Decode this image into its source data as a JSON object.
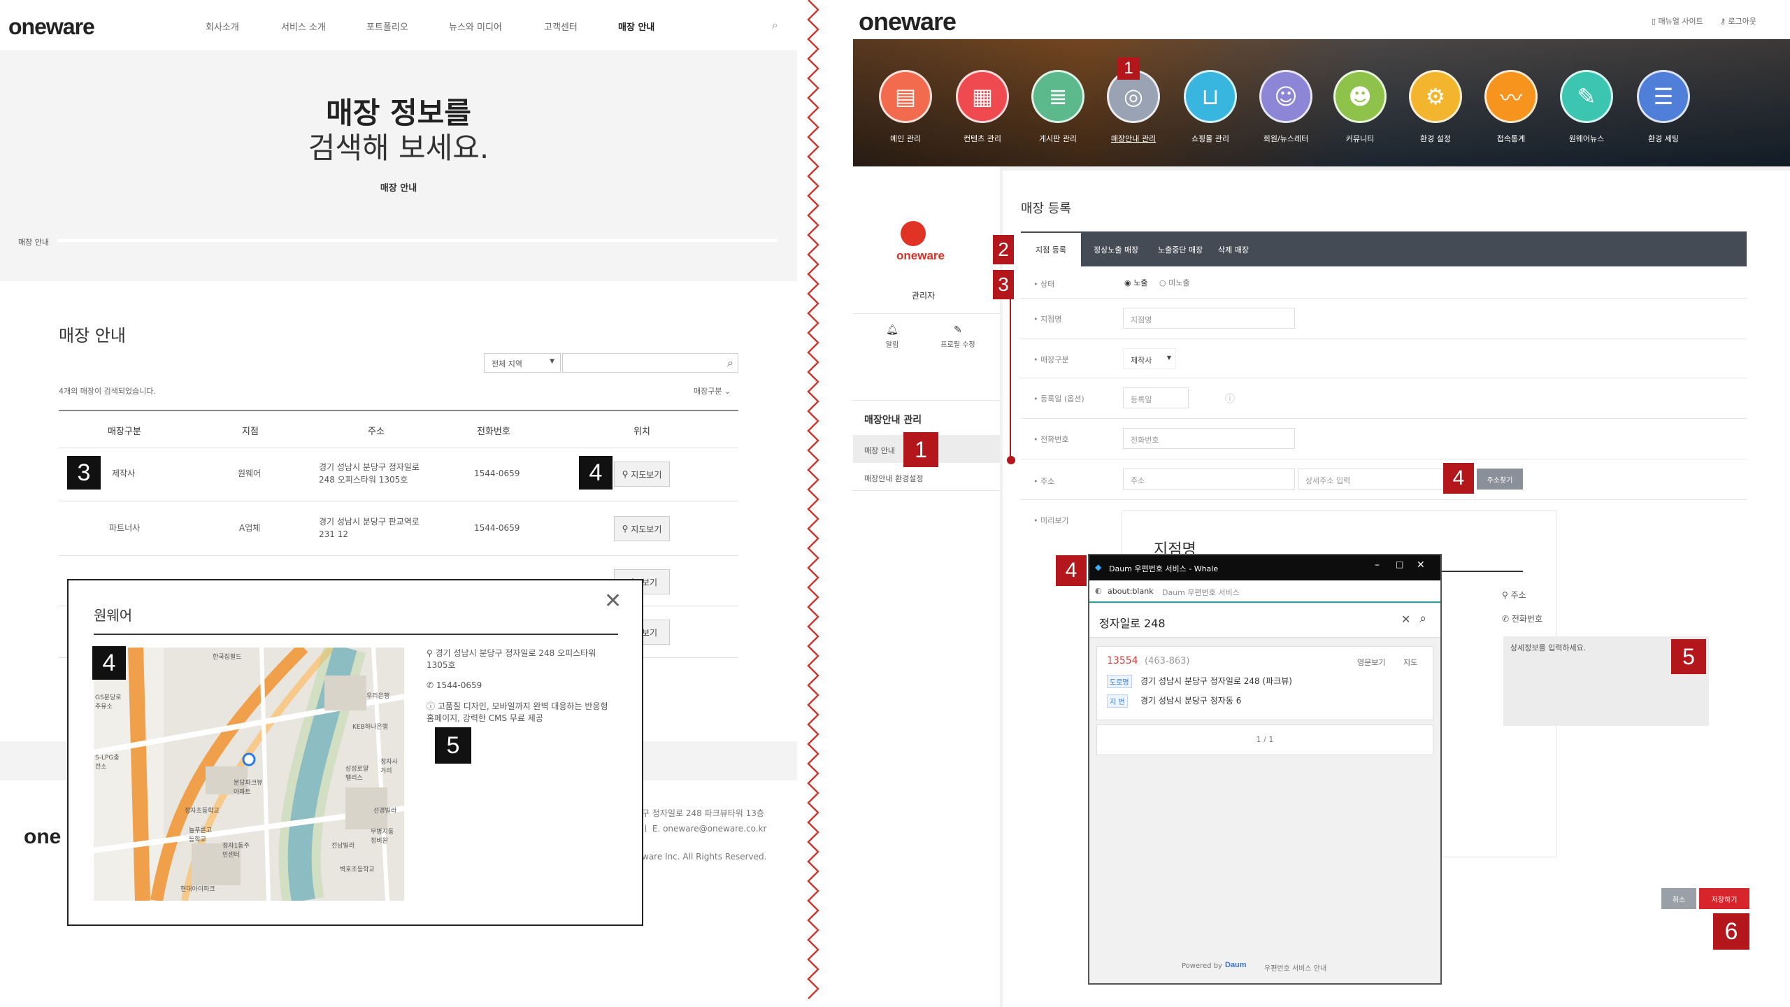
{
  "left": {
    "logo": "oneware",
    "nav": [
      "회사소개",
      "서비스 소개",
      "포트폴리오",
      "뉴스와 미디어",
      "고객센터",
      "매장 안내"
    ],
    "hero_title_bold": "매장 정보를",
    "hero_title_light": "검색해 보세요.",
    "hero_sub": "매장 안내",
    "breadcrumb": "매장 안내",
    "section_title": "매장 안내",
    "region_select": "전체 지역",
    "result_count": "4개의 매장이 검색되었습니다.",
    "sort_label": "매장구분",
    "columns": [
      "매장구분",
      "지점",
      "주소",
      "전화번호",
      "위치"
    ],
    "rows": [
      {
        "type": "제작사",
        "branch": "원웨어",
        "addr1": "경기 성남시 분당구 정자일로",
        "addr2": "248 오피스타워 1305호",
        "phone": "1544-0659",
        "map": "지도보기"
      },
      {
        "type": "파트너사",
        "branch": "A업체",
        "addr1": "경기 성남시 분당구 판교역로",
        "addr2": "231 12",
        "phone": "1544-0659",
        "map": "지도보기"
      }
    ],
    "map_btn": "지도보기",
    "modal": {
      "title": "원웨어",
      "address": "경기 성남시 분당구 정자일로 248 오피스타워 1305호",
      "phone": "1544-0659",
      "desc": "고품질 디자인, 모바일까지 완벽 대응하는 반응형 홈페이지, 강력한 CMS 무료 제공",
      "map_labels": [
        "한국집필드",
        "GS분당로주유소",
        "S-LPG충전소",
        "우리은행",
        "KEB하나은행",
        "분당파크뷰아파트",
        "정자초등학교",
        "늘푸른고등학교",
        "정자1동주민센터",
        "현대아이파크",
        "삼성로얄팰리스",
        "선경빌라",
        "정자사거리",
        "무병지동 정비원",
        "벽호초등학교",
        "전남빌라"
      ]
    },
    "footer_addr": "구 정자일로 248 파크뷰타워 13층",
    "footer_email": "ㅣ E. oneware@oneware.co.kr",
    "footer_copy": "ware Inc.  All Rights Reserved.",
    "footer_logo": "one"
  },
  "right": {
    "logo": "oneware",
    "top_links": [
      "매뉴얼 사이트",
      "로그아웃"
    ],
    "menu": [
      {
        "label": "메인 관리",
        "color": "#f26b4e",
        "icon": "▤"
      },
      {
        "label": "컨텐츠 관리",
        "color": "#ef4a4f",
        "icon": "▦"
      },
      {
        "label": "게시판 관리",
        "color": "#5bb98c",
        "icon": "≣"
      },
      {
        "label": "매장안내 관리",
        "color": "#9aa3b3",
        "icon": "◎"
      },
      {
        "label": "쇼핑몰 관리",
        "color": "#38b6e0",
        "icon": "⊔"
      },
      {
        "label": "회원/뉴스레터",
        "color": "#8d86d6",
        "icon": "☺"
      },
      {
        "label": "커뮤니티",
        "color": "#8ec24a",
        "icon": "☻"
      },
      {
        "label": "환경 설정",
        "color": "#f4b52e",
        "icon": "⚙"
      },
      {
        "label": "접속통계",
        "color": "#f7941d",
        "icon": "〰"
      },
      {
        "label": "원웨어뉴스",
        "color": "#3cc5b0",
        "icon": "✎"
      },
      {
        "label": "환경 세팅",
        "color": "#4f7fd9",
        "icon": "☰"
      }
    ],
    "sidebar_brand": "oneware",
    "sidebar_role": "관리자",
    "sidebar_alarm": "알림",
    "sidebar_profile": "프로필 수정",
    "sidebar_section": "매장안내 관리",
    "sidebar_items": [
      "매장 안내",
      "매장안내 환경설정"
    ],
    "page_title": "매장 등록",
    "tabs": [
      "지점 등록",
      "정상노출 매장",
      "노출중단 매장",
      "삭제 매장"
    ],
    "form": {
      "status_label": "상태",
      "status_options": [
        "노출",
        "미노출"
      ],
      "name_label": "지점명",
      "name_placeholder": "지점명",
      "type_label": "매장구분",
      "type_value": "제작사",
      "date_label": "등록일 (옵션)",
      "date_placeholder": "등록일",
      "phone_label": "전화번호",
      "phone_placeholder": "전화번호",
      "addr_label": "주소",
      "addr_placeholder": "주소",
      "addr_detail_placeholder": "상세주소 입력",
      "addr_btn": "주소찾기",
      "preview_label": "미리보기",
      "preview_title": "지점명",
      "preview_addr": "주소",
      "preview_phone": "전화번호",
      "preview_detail": "상세정보를 입력하세요.",
      "cancel_btn": "취소",
      "save_btn": "저장하기"
    },
    "popup": {
      "title": "Daum 우편번호 서비스 - Whale",
      "url": "about:blank",
      "url_desc": "Daum 우편번호 서비스",
      "query": "정자일로 248",
      "zip": "13554",
      "zip_old": "(463-863)",
      "en_label": "영문보기",
      "map_label": "지도",
      "road_tag": "도로명",
      "road_addr": "경기 성남시 분당구 정자일로 248 (파크뷰)",
      "lot_tag": "지 번",
      "lot_addr": "경기 성남시 분당구 정자동 6",
      "pager": "1 / 1",
      "powered": "Powered by",
      "daum": "Daum",
      "guide": "우편번호 서비스 안내"
    }
  },
  "badges": {
    "b1": "1",
    "b2": "2",
    "b3": "3",
    "b4": "4",
    "b5": "5",
    "b6": "6"
  }
}
